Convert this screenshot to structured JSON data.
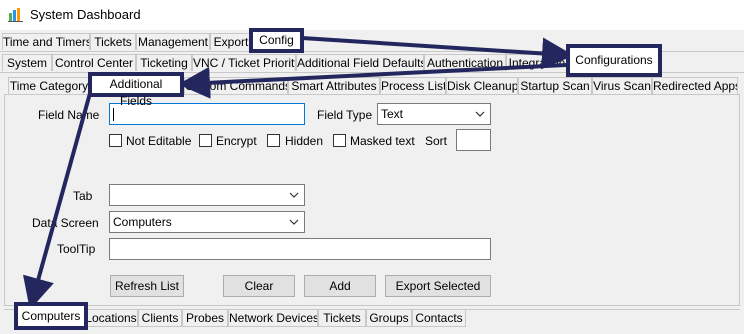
{
  "window": {
    "title": "System Dashboard"
  },
  "tabs_row1": [
    "Time and Timers",
    "Tickets",
    "Management",
    "Export",
    "Config"
  ],
  "tabs_row2": [
    "System",
    "Control Center",
    "Ticketing",
    "VNC / Ticket Priority",
    "Additional Field Defaults",
    "Authentication",
    "Integration",
    "Configurations"
  ],
  "tabs_row3": [
    "Time Category",
    "Additional Fields",
    "Custom Commands",
    "Smart Attributes",
    "Process List",
    "Disk Cleanup",
    "Startup Scan",
    "Virus Scan",
    "Redirected Apps"
  ],
  "form": {
    "field_name_label": "Field Name",
    "field_name_value": "",
    "field_type_label": "Field Type",
    "field_type_value": "Text",
    "not_editable_label": "Not Editable",
    "encrypt_label": "Encrypt",
    "hidden_label": "Hidden",
    "masked_text_label": "Masked text",
    "sort_label": "Sort",
    "sort_value": "",
    "tab_label": "Tab",
    "tab_value": "",
    "data_screen_label": "Data Screen",
    "data_screen_value": "Computers",
    "tooltip_label": "ToolTip",
    "tooltip_value": ""
  },
  "buttons": {
    "refresh_list": "Refresh List",
    "clear": "Clear",
    "add": "Add",
    "export_selected": "Export Selected"
  },
  "bottom_tabs": [
    "Computers",
    "Locations",
    "Clients",
    "Probes",
    "Network Devices",
    "Tickets",
    "Groups",
    "Contacts"
  ],
  "colors": {
    "highlight_border": "#23275e",
    "focus_border": "#0078d7"
  },
  "icons": {
    "app": "dashboard-app-icon",
    "dropdown": "chevron-down-icon"
  }
}
